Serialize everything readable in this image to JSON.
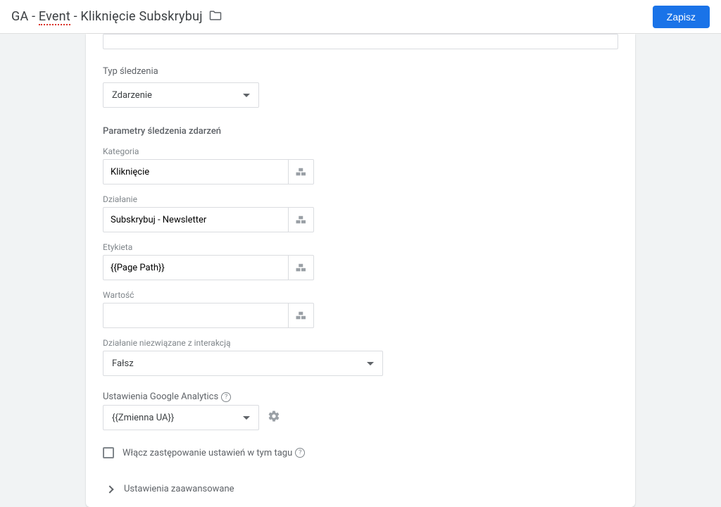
{
  "header": {
    "title_prefix": "GA - ",
    "title_event": "Event",
    "title_suffix": " - Kliknięcie Subskrybuj",
    "save_label": "Zapisz"
  },
  "form": {
    "tracking_type_label": "Typ śledzenia",
    "tracking_type_value": "Zdarzenie",
    "event_params_label": "Parametry śledzenia zdarzeń",
    "category": {
      "label": "Kategoria",
      "value": "Kliknięcie"
    },
    "action": {
      "label": "Działanie",
      "value": "Subskrybuj - Newsletter"
    },
    "label": {
      "label": "Etykieta",
      "value": "{{Page Path}}"
    },
    "value": {
      "label": "Wartość",
      "value": ""
    },
    "non_interaction": {
      "label": "Działanie niezwiązane z interakcją",
      "value": "Fałsz"
    },
    "ga_settings": {
      "label": "Ustawienia Google Analytics",
      "value": "{{Zmienna UA}}"
    },
    "override_checkbox_label": "Włącz zastępowanie ustawień w tym tagu",
    "advanced_label": "Ustawienia zaawansowane"
  }
}
